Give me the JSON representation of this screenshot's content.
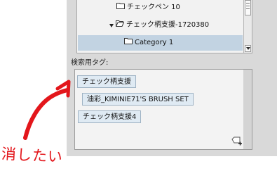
{
  "tree": {
    "items": [
      {
        "label": "チェックペン 10",
        "expanded": false,
        "selected": false
      },
      {
        "label": "チェック柄支援-1720380",
        "expanded": true,
        "selected": false
      },
      {
        "label": "Category 1",
        "expanded": false,
        "selected": true
      }
    ]
  },
  "search_tags": {
    "label": "検索用タグ:",
    "tags": [
      "チェック柄支援",
      "油彩_KIMINIE71'S BRUSH SET",
      "チェック柄支援4"
    ],
    "add_tag_icon": "tag-add-icon"
  },
  "annotation": {
    "text": "消したい",
    "color": "#e3161b"
  },
  "colors": {
    "panel_bg": "#d9d9d9",
    "selected_row": "#c2d3e2",
    "tag_bg": "#dfeaf3"
  }
}
